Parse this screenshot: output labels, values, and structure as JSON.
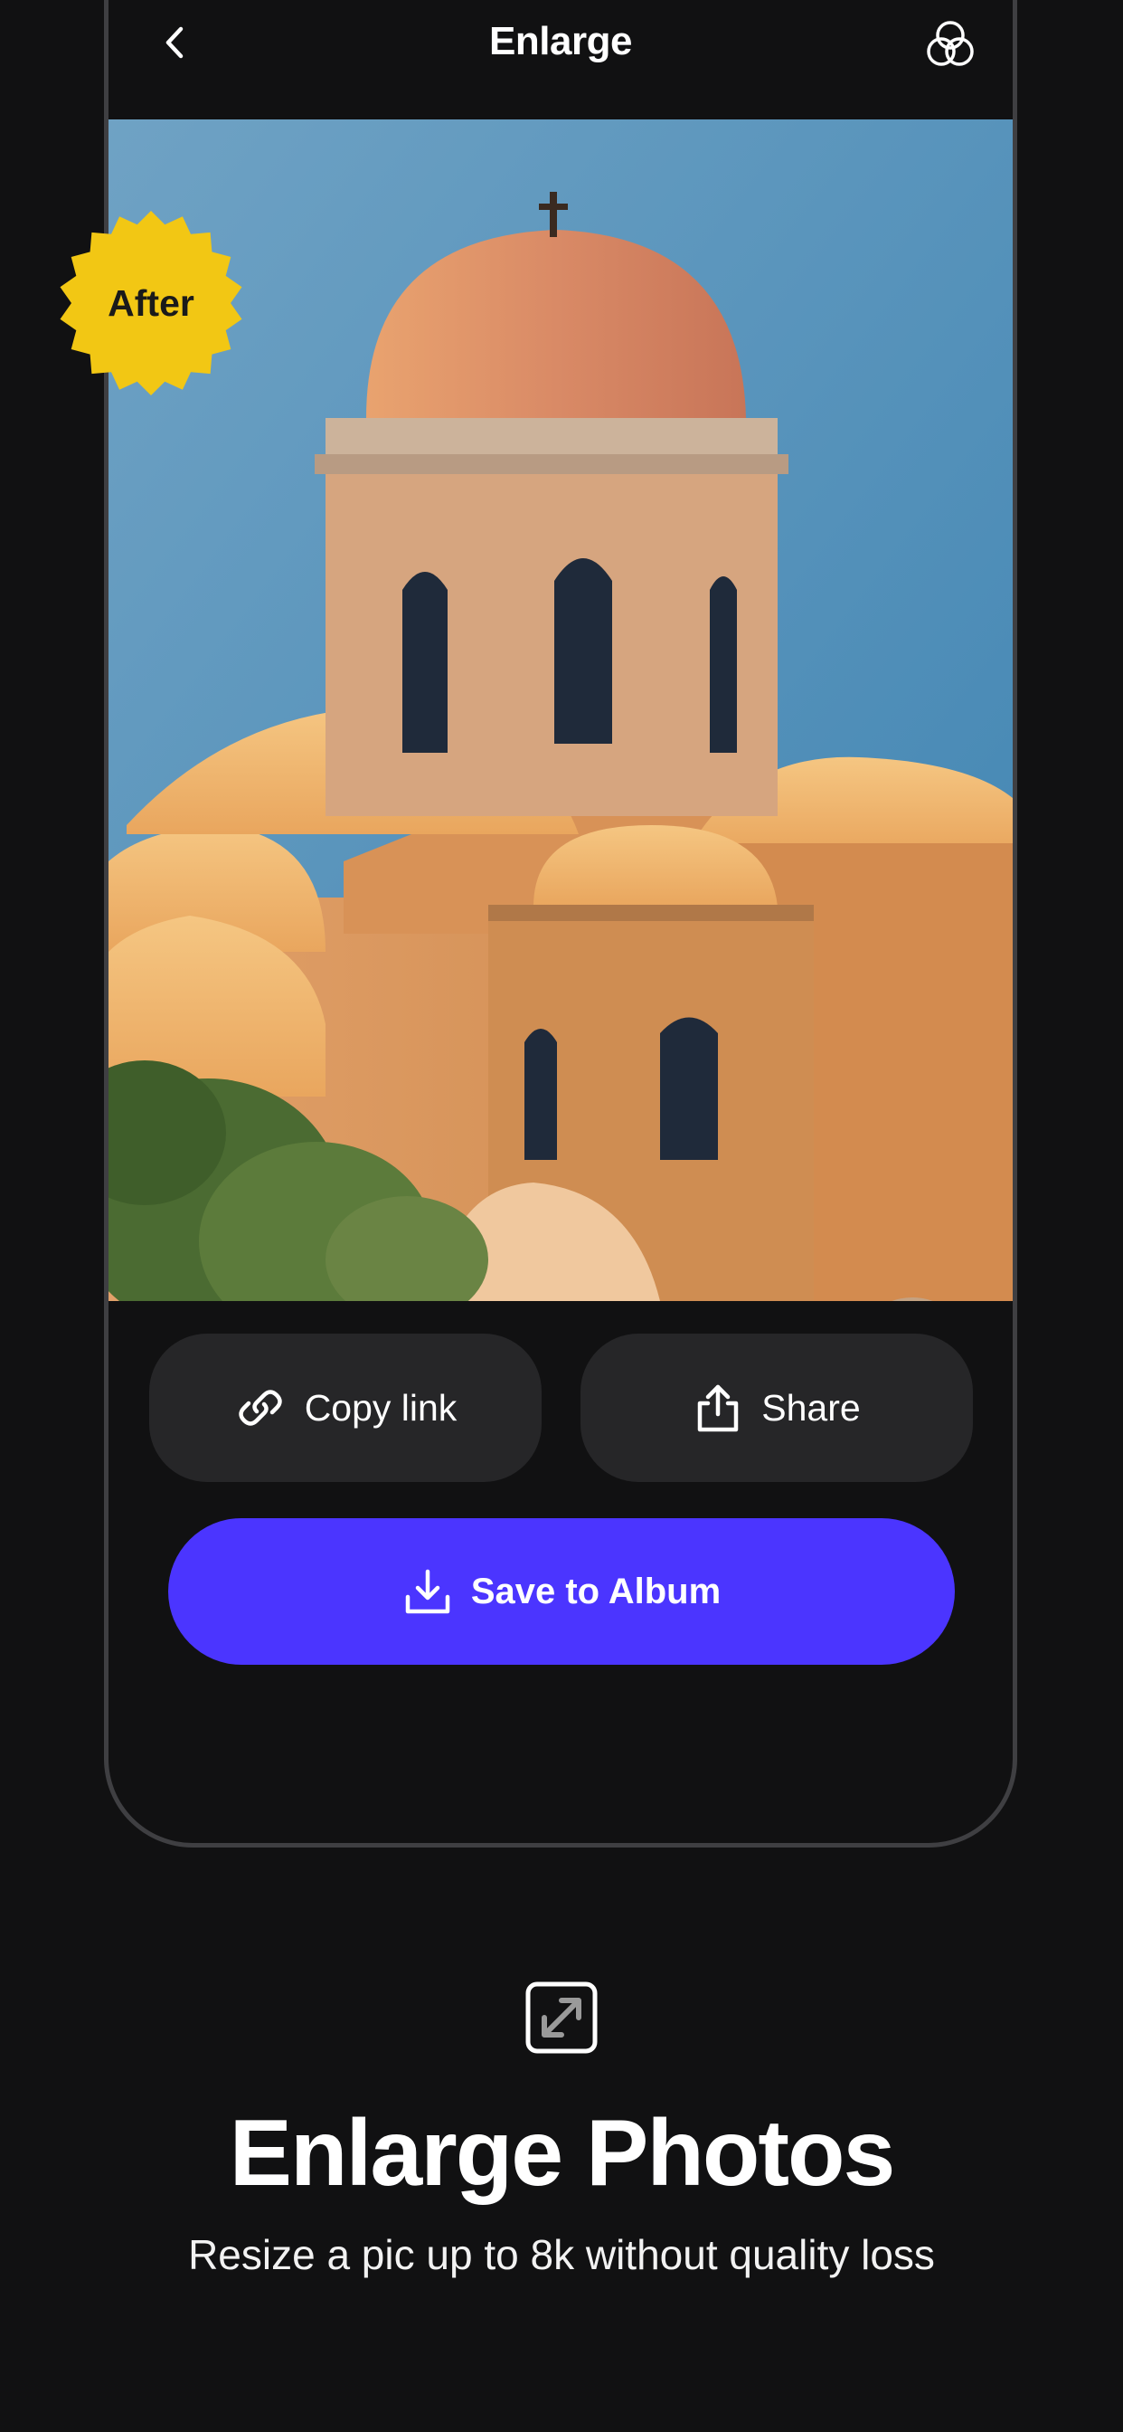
{
  "header": {
    "title": "Enlarge",
    "back_icon": "chevron-left-icon",
    "filter_icon": "overlapping-circles-icon"
  },
  "photo": {
    "badge_label": "After",
    "badge_color": "#f2c714",
    "compare_icon": "split-compare-icon"
  },
  "actions": {
    "copy_link_label": "Copy link",
    "copy_link_icon": "link-icon",
    "share_label": "Share",
    "share_icon": "share-icon",
    "save_label": "Save to Album",
    "save_icon": "download-icon",
    "save_color": "#4b35ff"
  },
  "feature": {
    "icon": "expand-icon",
    "title": "Enlarge Photos",
    "subtitle": "Resize a pic up to 8k without quality loss"
  }
}
